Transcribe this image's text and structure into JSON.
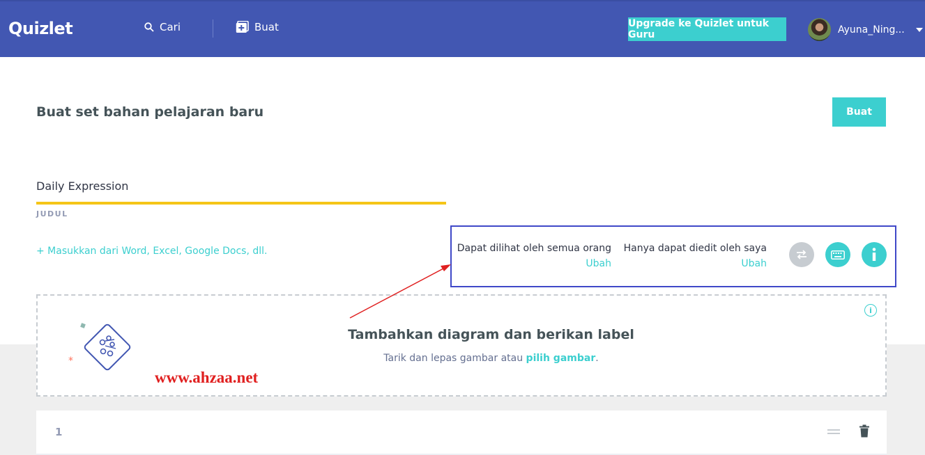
{
  "header": {
    "logo": "Quizlet",
    "search_label": "Cari",
    "create_label": "Buat",
    "upgrade_label": "Upgrade ke Quizlet untuk Guru",
    "username": "Ayuna_Ning..."
  },
  "main": {
    "page_title": "Buat set bahan pelajaran baru",
    "create_button": "Buat",
    "title_value": "Daily Expression",
    "title_label": "JUDUL",
    "import_link": "+ Masukkan dari Word, Excel, Google Docs, dll.",
    "visibility": {
      "text": "Dapat dilihat oleh semua orang",
      "change": "Ubah"
    },
    "edit_permission": {
      "text": "Hanya dapat diedit oleh saya",
      "change": "Ubah"
    }
  },
  "diagram": {
    "title": "Tambahkan diagram dan berikan label",
    "subtitle_before": "Tarik dan lepas gambar atau ",
    "subtitle_link": "pilih gambar",
    "subtitle_after": "."
  },
  "watermark": "www.ahzaa.net",
  "terms": [
    {
      "number": "1"
    }
  ],
  "colors": {
    "header": "#4257b2",
    "accent": "#3ccfcf",
    "title_underline": "#f5c518",
    "highlight_box": "#3f48c8",
    "annotation_arrow": "#e02020"
  },
  "icons": [
    "search-icon",
    "create-plus-icon",
    "swap-icon",
    "keyboard-icon",
    "info-icon",
    "diagram-icon",
    "drag-handle-icon",
    "trash-icon"
  ]
}
